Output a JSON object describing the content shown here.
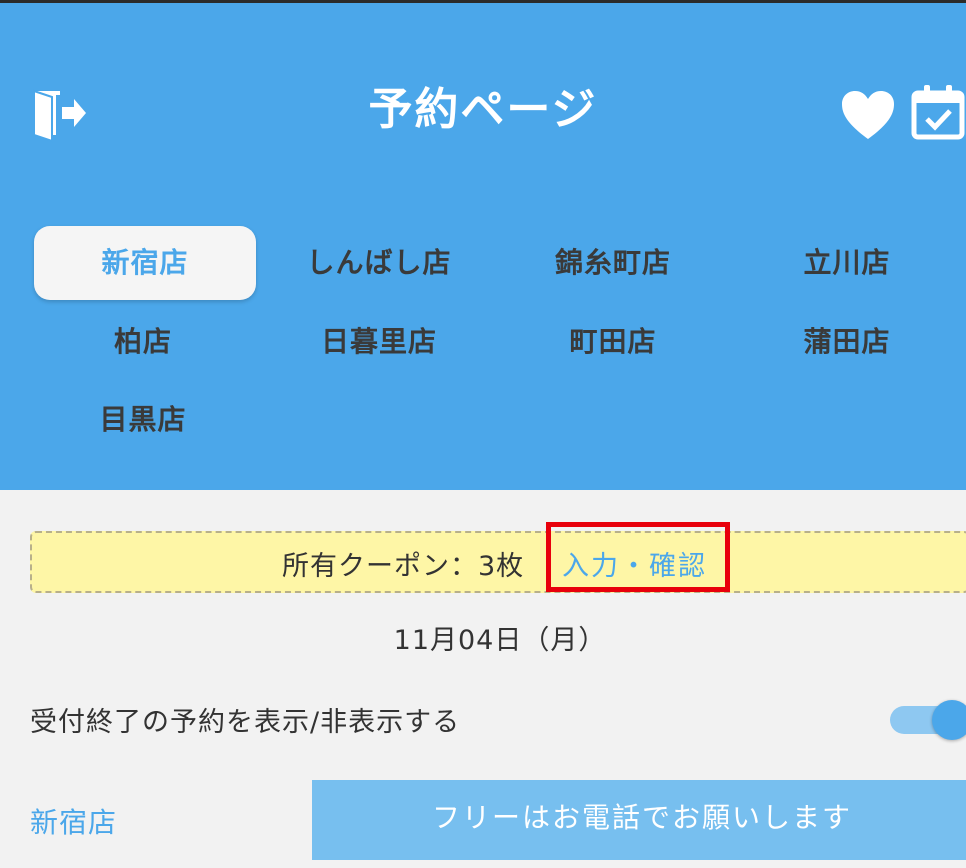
{
  "header": {
    "title": "予約ページ",
    "background": "#4ba7ea",
    "icons": {
      "left": "logout-icon",
      "fav": "heart-icon",
      "calendar": "calendar-check-icon"
    }
  },
  "stores": [
    {
      "label": "新宿店",
      "active": true
    },
    {
      "label": "しんばし店",
      "active": false
    },
    {
      "label": "錦糸町店",
      "active": false
    },
    {
      "label": "立川店",
      "active": false
    },
    {
      "label": "柏店",
      "active": false
    },
    {
      "label": "日暮里店",
      "active": false
    },
    {
      "label": "町田店",
      "active": false
    },
    {
      "label": "蒲田店",
      "active": false
    },
    {
      "label": "目黒店",
      "active": false
    }
  ],
  "coupon": {
    "text": "所有クーポン：3枚",
    "link": "入力・確認"
  },
  "date": "11月04日（月）",
  "toggle": {
    "label": "受付終了の予約を表示/非表示する",
    "on": true
  },
  "footer": {
    "store_link": "新宿店",
    "call_button": "フリーはお電話でお願いします"
  },
  "colors": {
    "accent": "#4ba7ea",
    "highlight": "#e8000b",
    "coupon_bg": "#fef6a6"
  }
}
